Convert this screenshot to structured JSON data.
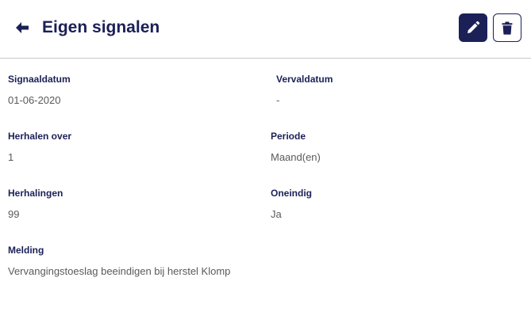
{
  "header": {
    "title": "Eigen signalen",
    "back_icon": "arrow-left-icon",
    "edit_icon": "pencil-icon",
    "delete_icon": "trash-icon",
    "accent_color": "#1b2057"
  },
  "fields": {
    "signaaldatum": {
      "label": "Signaaldatum",
      "value": "01-06-2020"
    },
    "vervaldatum": {
      "label": "Vervaldatum",
      "value": "-"
    },
    "herhalen_over": {
      "label": "Herhalen over",
      "value": "1"
    },
    "periode": {
      "label": "Periode",
      "value": "Maand(en)"
    },
    "herhalingen": {
      "label": "Herhalingen",
      "value": "99"
    },
    "oneindig": {
      "label": "Oneindig",
      "value": "Ja"
    },
    "melding": {
      "label": "Melding",
      "value": "Vervangingstoeslag beeindigen bij herstel Klomp"
    }
  }
}
